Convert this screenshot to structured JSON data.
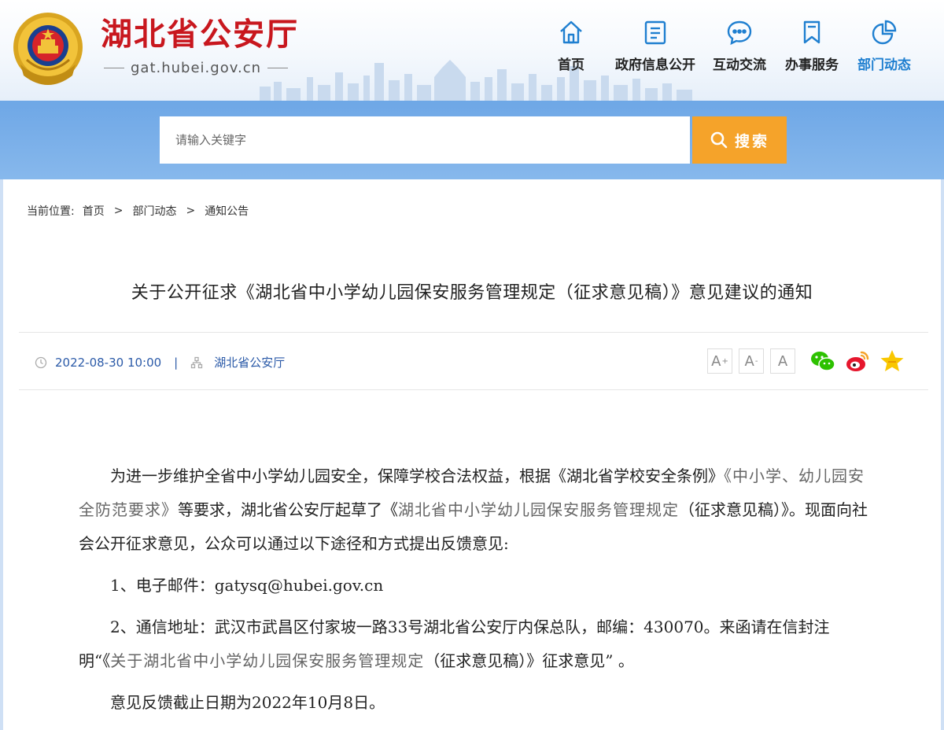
{
  "header": {
    "site_title": "湖北省公安厅",
    "site_url": "gat.hubei.gov.cn"
  },
  "nav": {
    "items": [
      {
        "label": "首页",
        "icon": "home-icon"
      },
      {
        "label": "政府信息公开",
        "icon": "document-list-icon"
      },
      {
        "label": "互动交流",
        "icon": "chat-bubble-icon"
      },
      {
        "label": "办事服务",
        "icon": "bookmark-icon"
      },
      {
        "label": "部门动态",
        "icon": "pie-chart-icon"
      }
    ],
    "active_index": 4
  },
  "search": {
    "placeholder": "请输入关键字",
    "button_label": "搜索"
  },
  "breadcrumb": {
    "prefix": "当前位置:",
    "items": [
      "首页",
      "部门动态",
      "通知公告"
    ],
    "separator": ">"
  },
  "article": {
    "title": "关于公开征求《湖北省中小学幼儿园保安服务管理规定（征求意见稿）》意见建议的通知",
    "date": "2022-08-30 10:00",
    "meta_divider": "|",
    "source": "湖北省公安厅",
    "font_controls": [
      "A+",
      "A-",
      "A"
    ],
    "share_icons": [
      "wechat-icon",
      "weibo-icon",
      "favorite-star-icon"
    ],
    "paragraphs": {
      "p1_a": "为进一步维护全省中小学幼儿园安全，保障学校合法权益，根据《湖北省学校安全条例》",
      "p1_b": "《中小学、幼儿园安全防范要求》",
      "p1_c": "等要求，湖北省公安厅起草了《",
      "p1_d": "湖北省中小学幼儿园保安服务管理规定",
      "p1_e": "（征求意见稿）》。现面向社会公开征求意见，公众可以通过以下途径和方式提出反馈意见:",
      "p2": "1、电子邮件：gatysq@hubei.gov.cn",
      "p3_a": "2、通信地址：武汉市武昌区付家坡一路33号湖北省公安厅内保总队，邮编：430070。来函请在信封注明“《",
      "p3_b": "关于湖北省中小学幼儿园保安服务管理规定",
      "p3_c": "（征求意见稿）》征求意见”  。",
      "p4": "意见反馈截止日期为2022年10月8日。"
    }
  },
  "colors": {
    "brand_red": "#c8171e",
    "nav_blue": "#1f7fd0",
    "search_button": "#f5a32a",
    "link_blue": "#2b5aa8"
  }
}
